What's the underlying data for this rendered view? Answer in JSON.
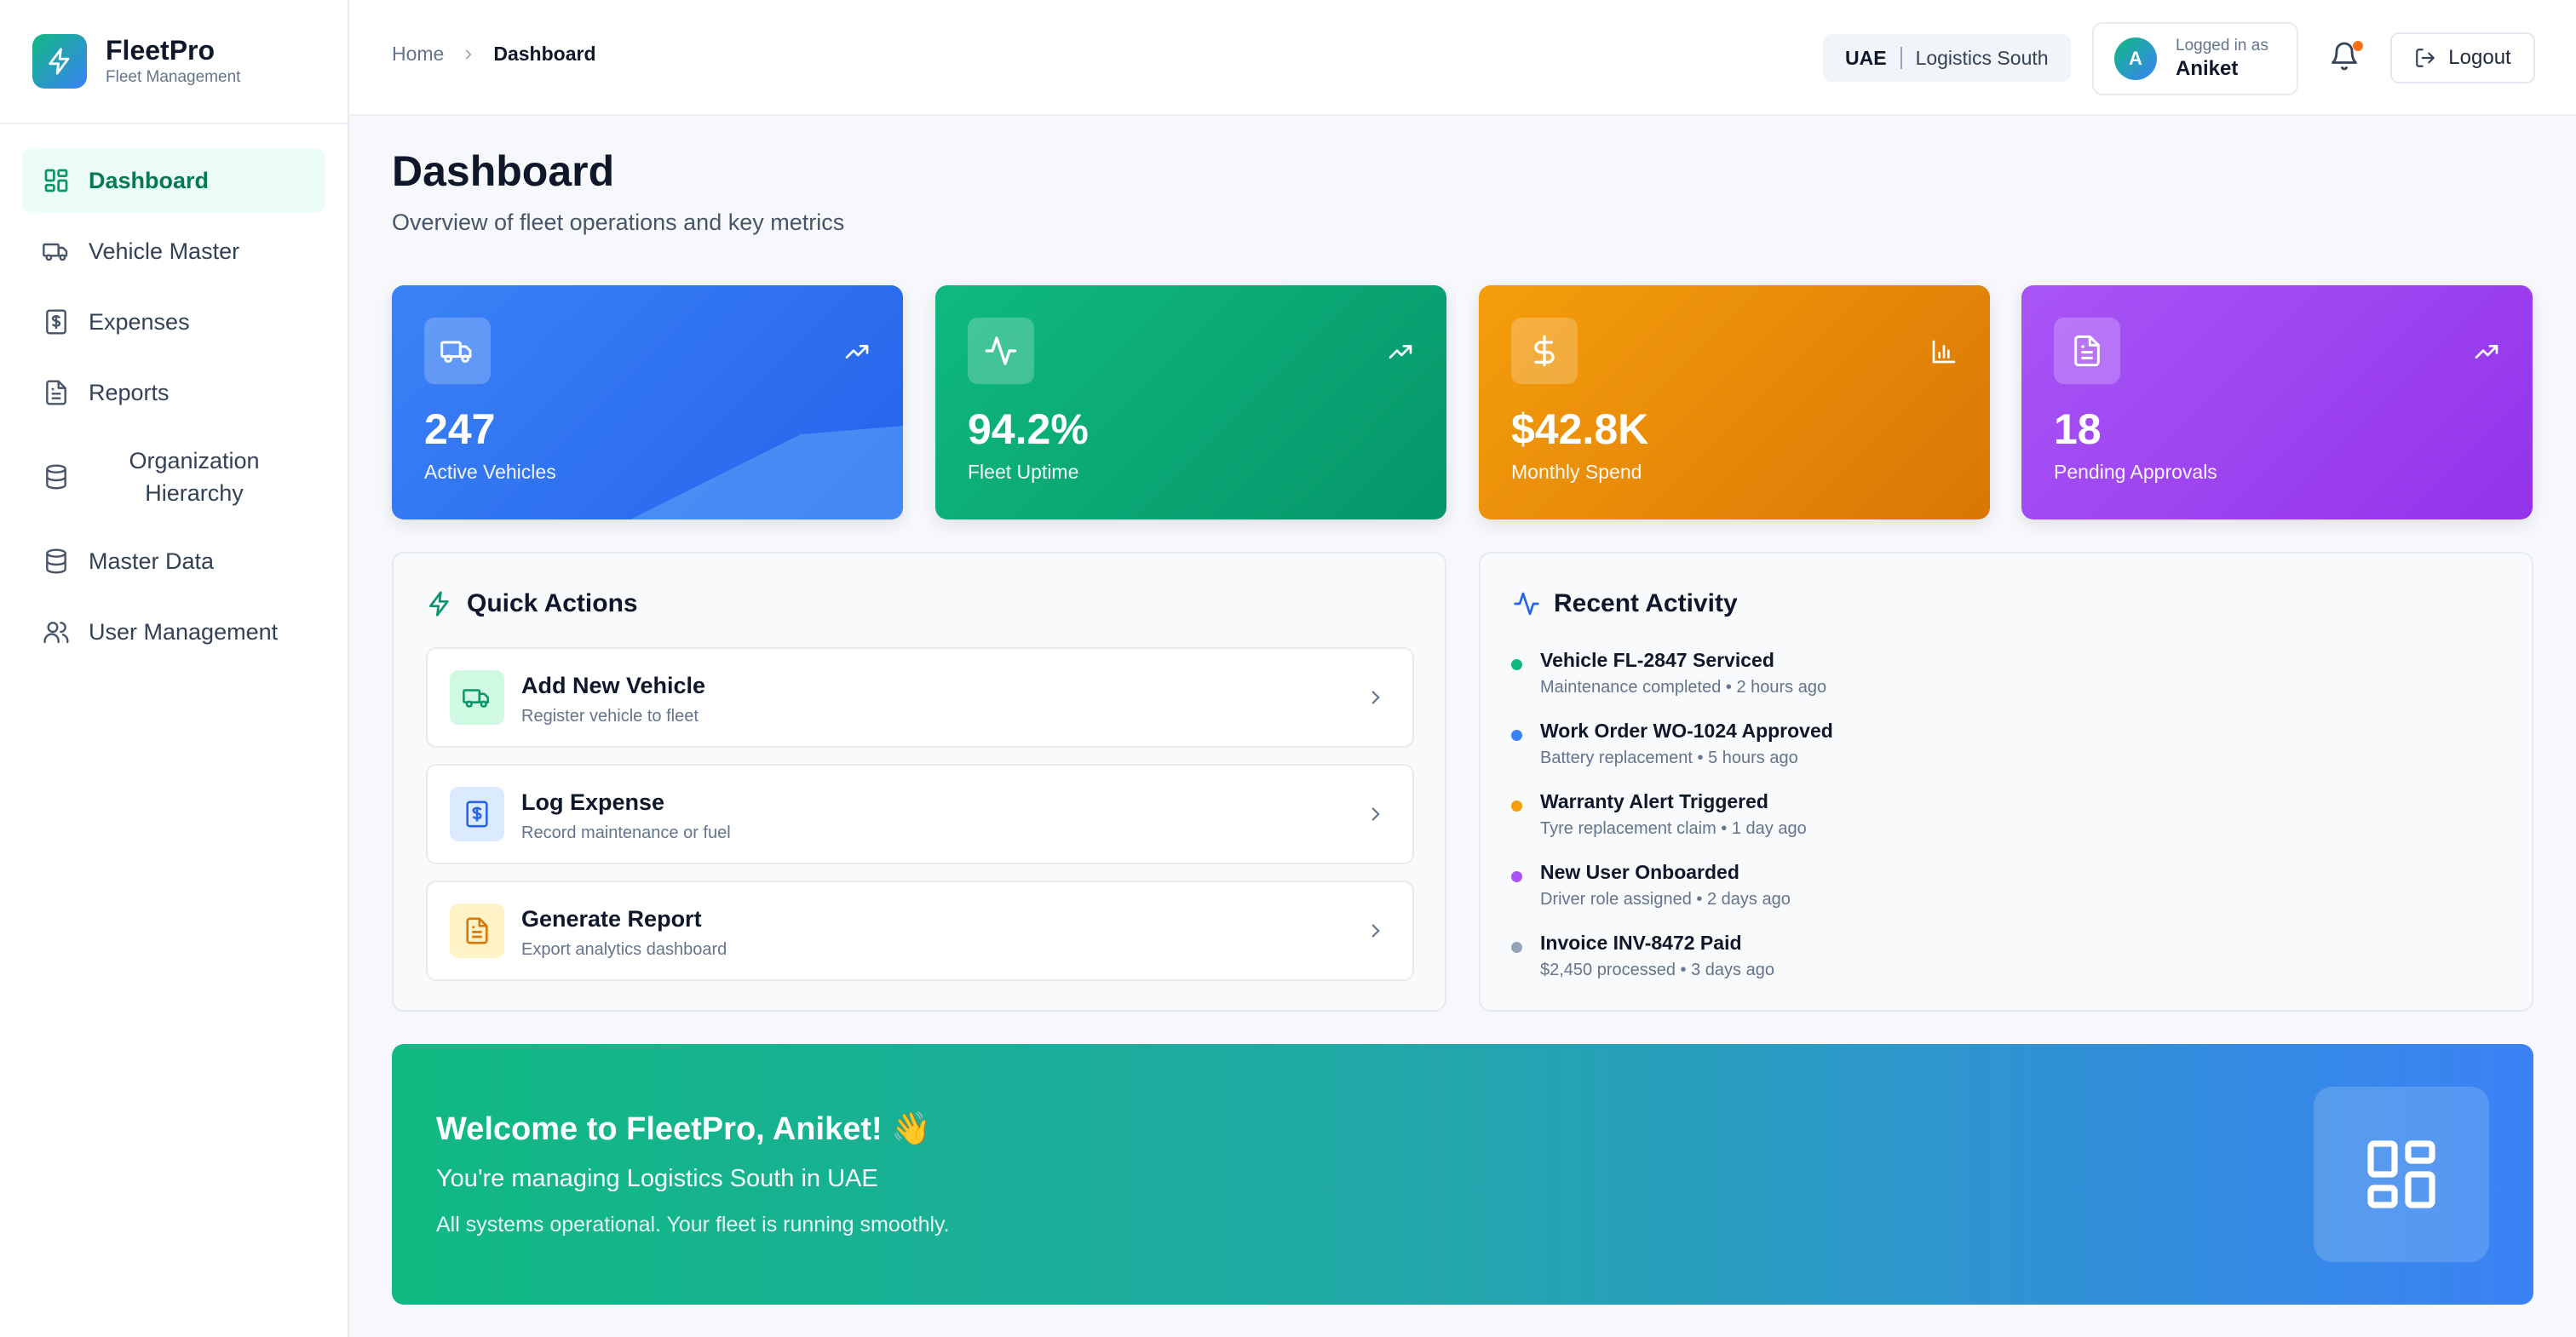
{
  "brand": {
    "name": "FleetPro",
    "subtitle": "Fleet Management"
  },
  "sidebar": {
    "items": [
      {
        "label": "Dashboard",
        "icon": "dashboard-grid-icon",
        "active": true
      },
      {
        "label": "Vehicle Master",
        "icon": "truck-icon"
      },
      {
        "label": "Expenses",
        "icon": "dollar-receipt-icon"
      },
      {
        "label": "Reports",
        "icon": "document-icon"
      },
      {
        "label": "Organization Hierarchy",
        "icon": "database-icon"
      },
      {
        "label": "Master Data",
        "icon": "database-icon"
      },
      {
        "label": "User Management",
        "icon": "users-icon"
      }
    ]
  },
  "header": {
    "breadcrumb": {
      "home": "Home",
      "current": "Dashboard"
    },
    "region": {
      "country": "UAE",
      "name": "Logistics South"
    },
    "user": {
      "initial": "A",
      "logged_label": "Logged in as",
      "name": "Aniket"
    },
    "logout_label": "Logout"
  },
  "page": {
    "title": "Dashboard",
    "subtitle": "Overview of fleet operations and key metrics"
  },
  "stats": [
    {
      "value": "247",
      "label": "Active Vehicles",
      "icon": "truck-icon",
      "color": "#3b82f6"
    },
    {
      "value": "94.2%",
      "label": "Fleet Uptime",
      "icon": "activity-icon",
      "color": "#10b981"
    },
    {
      "value": "$42.8K",
      "label": "Monthly Spend",
      "icon": "dollar-icon",
      "color": "#f59e0b"
    },
    {
      "value": "18",
      "label": "Pending Approvals",
      "icon": "document-icon",
      "color": "#a855f7"
    }
  ],
  "quick_actions": {
    "title": "Quick Actions",
    "items": [
      {
        "title": "Add New Vehicle",
        "subtitle": "Register vehicle to fleet"
      },
      {
        "title": "Log Expense",
        "subtitle": "Record maintenance or fuel"
      },
      {
        "title": "Generate Report",
        "subtitle": "Export analytics dashboard"
      }
    ]
  },
  "recent_activity": {
    "title": "Recent Activity",
    "items": [
      {
        "title": "Vehicle FL-2847 Serviced",
        "subtitle": "Maintenance completed • 2 hours ago",
        "color": "#10b981"
      },
      {
        "title": "Work Order WO-1024 Approved",
        "subtitle": "Battery replacement • 5 hours ago",
        "color": "#3b82f6"
      },
      {
        "title": "Warranty Alert Triggered",
        "subtitle": "Tyre replacement claim • 1 day ago",
        "color": "#f59e0b"
      },
      {
        "title": "New User Onboarded",
        "subtitle": "Driver role assigned • 2 days ago",
        "color": "#a855f7"
      },
      {
        "title": "Invoice INV-8472 Paid",
        "subtitle": "$2,450 processed • 3 days ago",
        "color": "#94a3b8"
      }
    ]
  },
  "welcome": {
    "title": "Welcome to FleetPro, Aniket! 👋",
    "subtitle": "You're managing Logistics South in UAE",
    "status": "All systems operational. Your fleet is running smoothly."
  },
  "colors": {
    "accent_green": "#10b981",
    "accent_blue": "#3b82f6",
    "notification_dot": "#f97316"
  }
}
